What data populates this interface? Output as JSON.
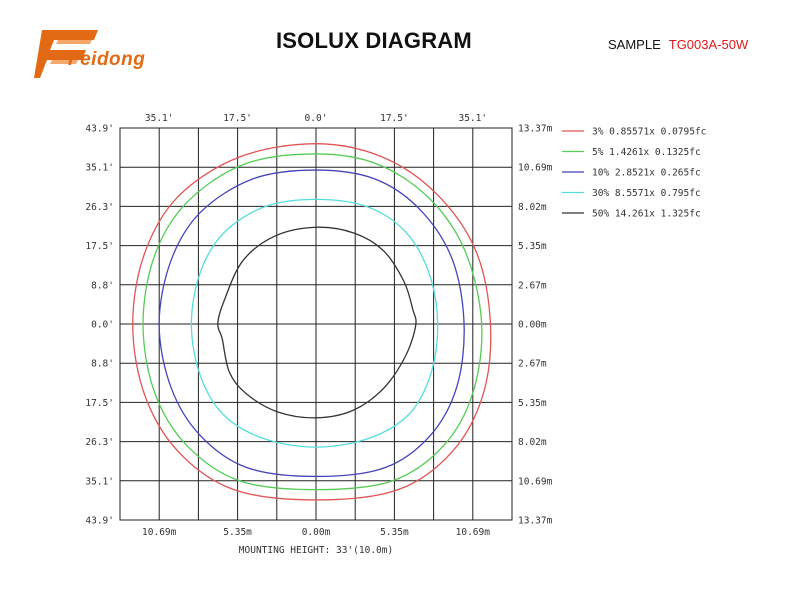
{
  "header": {
    "logo_text": "Feidong",
    "title": "ISOLUX DIAGRAM",
    "sample_label": "SAMPLE",
    "sample_code": "TG003A-50W"
  },
  "colors": {
    "logo": "#e36a14",
    "sample_code": "#e01818",
    "grid": "#222222"
  },
  "chart_data": {
    "type": "isolux",
    "xlabel": "MOUNTING HEIGHT: 33'(10.0m)",
    "x_ticks_top": [
      "35.1'",
      "17.5'",
      "0.0'",
      "17.5'",
      "35.1'"
    ],
    "x_ticks_bottom": [
      "10.69m",
      "5.35m",
      "0.00m",
      "5.35m",
      "10.69m"
    ],
    "y_ticks_left": [
      "43.9'",
      "35.1'",
      "26.3'",
      "17.5'",
      "8.8'",
      "0.0'",
      "8.8'",
      "17.5'",
      "26.3'",
      "35.1'",
      "43.9'"
    ],
    "y_ticks_right": [
      "13.37m",
      "10.69m",
      "8.02m",
      "5.35m",
      "2.67m",
      "0.00m",
      "2.67m",
      "5.35m",
      "8.02m",
      "10.69m",
      "13.37m"
    ],
    "x_range_m": [
      -13.37,
      13.37
    ],
    "y_range_m": [
      -13.37,
      13.37
    ],
    "grid": true,
    "legend_position": "right",
    "series": [
      {
        "name": "3% 0.85571x 0.0795fc",
        "color": "#e05555",
        "points_m": [
          [
            0.0,
            12.3
          ],
          [
            4.5,
            11.4
          ],
          [
            8.2,
            8.9
          ],
          [
            10.9,
            5.0
          ],
          [
            11.9,
            0.0
          ],
          [
            11.4,
            -4.8
          ],
          [
            9.3,
            -8.7
          ],
          [
            5.6,
            -11.3
          ],
          [
            0.0,
            -12.0
          ],
          [
            -5.6,
            -11.3
          ],
          [
            -9.4,
            -8.7
          ],
          [
            -11.7,
            -4.8
          ],
          [
            -12.5,
            0.0
          ],
          [
            -11.7,
            4.8
          ],
          [
            -9.4,
            8.7
          ],
          [
            -5.2,
            11.4
          ]
        ]
      },
      {
        "name": "5% 1.4261x 0.1325fc",
        "color": "#55cc55",
        "points_m": [
          [
            0.0,
            11.6
          ],
          [
            4.2,
            10.9
          ],
          [
            7.8,
            8.5
          ],
          [
            10.2,
            4.9
          ],
          [
            11.3,
            0.0
          ],
          [
            10.7,
            -4.7
          ],
          [
            8.7,
            -8.3
          ],
          [
            5.2,
            -10.7
          ],
          [
            0.0,
            -11.3
          ],
          [
            -5.2,
            -10.7
          ],
          [
            -8.8,
            -8.3
          ],
          [
            -11.0,
            -4.7
          ],
          [
            -11.8,
            0.0
          ],
          [
            -11.0,
            4.7
          ],
          [
            -8.8,
            8.3
          ],
          [
            -4.9,
            10.9
          ]
        ]
      },
      {
        "name": "10% 2.8521x 0.265fc",
        "color": "#4444bb",
        "points_m": [
          [
            0.0,
            10.5
          ],
          [
            4.0,
            9.9
          ],
          [
            7.1,
            7.8
          ],
          [
            9.3,
            4.4
          ],
          [
            10.1,
            0.0
          ],
          [
            9.6,
            -4.3
          ],
          [
            7.8,
            -7.6
          ],
          [
            4.7,
            -9.8
          ],
          [
            0.0,
            -10.4
          ],
          [
            -4.7,
            -9.8
          ],
          [
            -7.9,
            -7.6
          ],
          [
            -9.9,
            -4.3
          ],
          [
            -10.7,
            0.0
          ],
          [
            -9.9,
            4.3
          ],
          [
            -7.9,
            7.6
          ],
          [
            -4.3,
            9.9
          ]
        ]
      },
      {
        "name": "30% 8.5571x 0.795fc",
        "color": "#55dddd",
        "points_m": [
          [
            0.0,
            8.5
          ],
          [
            3.5,
            8.0
          ],
          [
            6.1,
            6.3
          ],
          [
            7.7,
            3.5
          ],
          [
            8.3,
            0.0
          ],
          [
            7.8,
            -3.5
          ],
          [
            6.3,
            -6.2
          ],
          [
            3.6,
            -7.8
          ],
          [
            0.0,
            -8.4
          ],
          [
            -3.6,
            -7.8
          ],
          [
            -6.3,
            -6.2
          ],
          [
            -7.9,
            -3.5
          ],
          [
            -8.5,
            0.0
          ],
          [
            -7.9,
            3.5
          ],
          [
            -6.3,
            6.2
          ],
          [
            -3.5,
            8.0
          ]
        ]
      },
      {
        "name": "50% 14.261x 1.325fc",
        "color": "#333333",
        "points_m": [
          [
            0.0,
            6.6
          ],
          [
            2.6,
            6.2
          ],
          [
            4.6,
            5.0
          ],
          [
            6.0,
            2.9
          ],
          [
            6.6,
            1.0
          ],
          [
            6.8,
            -0.1
          ],
          [
            6.1,
            -2.2
          ],
          [
            4.6,
            -4.4
          ],
          [
            2.5,
            -5.9
          ],
          [
            0.0,
            -6.4
          ],
          [
            -2.6,
            -6.0
          ],
          [
            -4.7,
            -4.8
          ],
          [
            -5.9,
            -3.3
          ],
          [
            -6.4,
            -1.0
          ],
          [
            -6.7,
            0.0
          ],
          [
            -6.3,
            1.5
          ],
          [
            -5.0,
            4.3
          ],
          [
            -2.8,
            6.0
          ]
        ]
      }
    ]
  }
}
